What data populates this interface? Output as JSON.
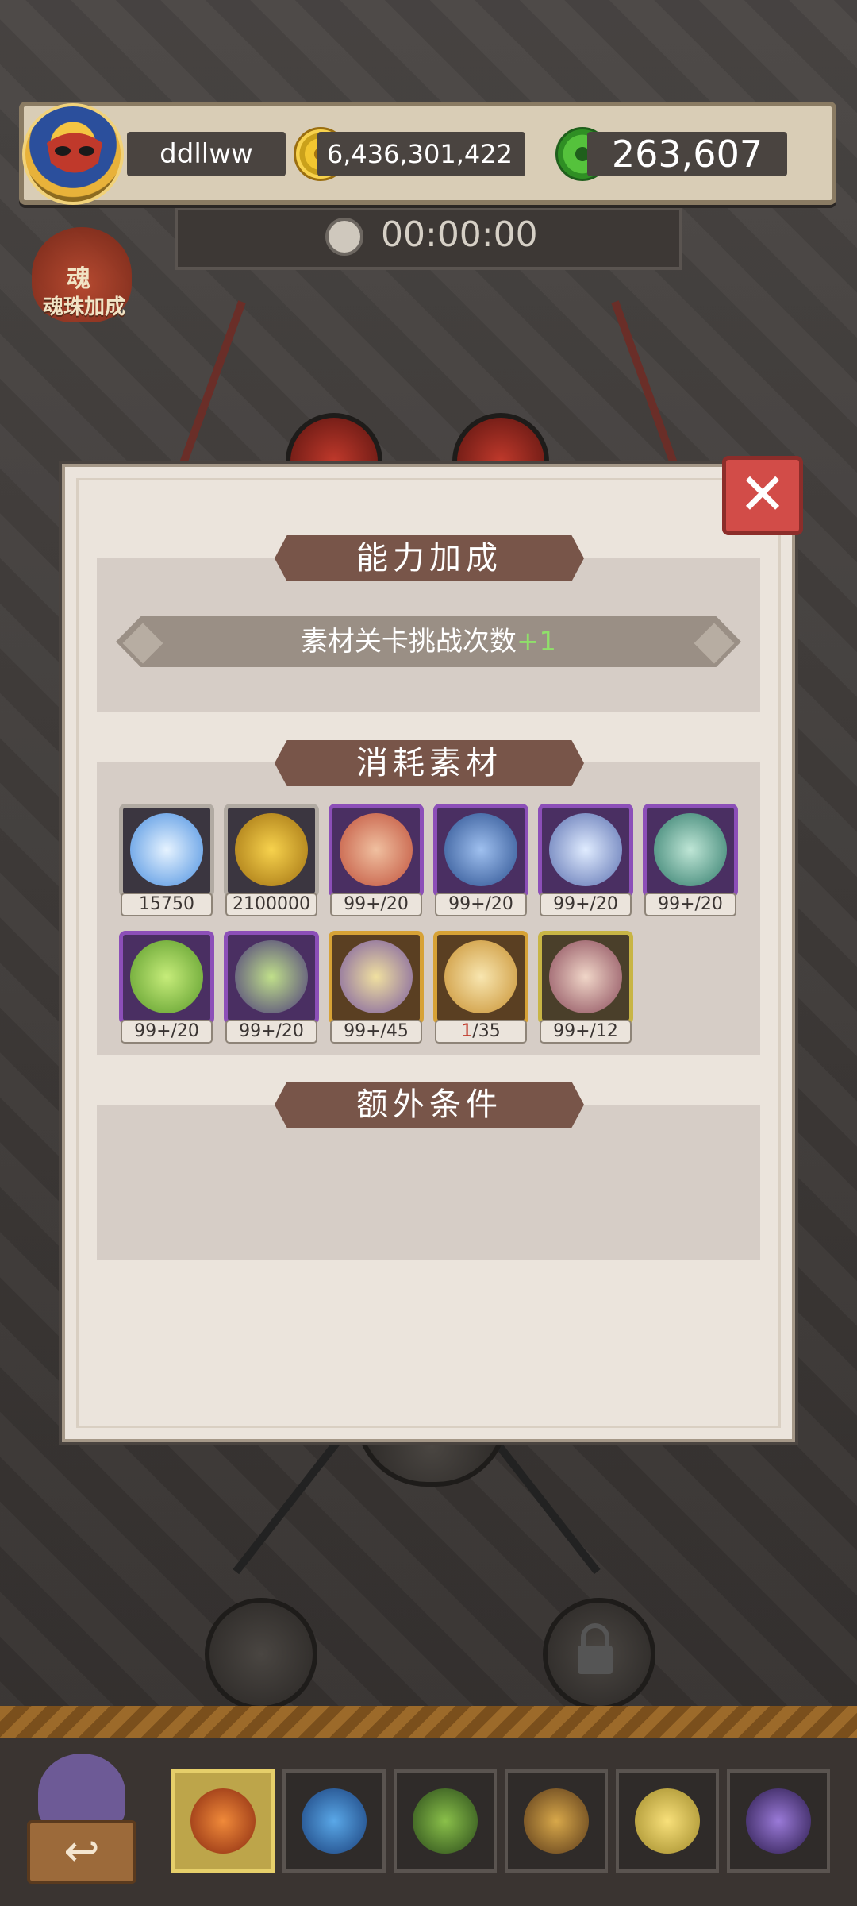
{
  "header": {
    "username": "ddllww",
    "gold": "6,436,301,422",
    "jade": "263,607",
    "timer": "00:00:00",
    "soul_bonus_char": "魂",
    "soul_bonus_label": "魂珠加成"
  },
  "modal": {
    "close_label": "✕",
    "sections": [
      {
        "title": "能力加成"
      },
      {
        "title": "消耗素材"
      },
      {
        "title": "额外条件"
      }
    ],
    "bonus_text": "素材关卡挑战次数",
    "bonus_plus": "+1",
    "materials": [
      {
        "icon": "blue-crystal-icon",
        "count": "15750",
        "frame": "gray"
      },
      {
        "icon": "gold-coin-stack-icon",
        "count": "2100000",
        "frame": "gray"
      },
      {
        "icon": "red-fire-orb-icon",
        "count": "99+/20",
        "frame": "purple"
      },
      {
        "icon": "blue-ice-orb-icon",
        "count": "99+/20",
        "frame": "purple"
      },
      {
        "icon": "cube-orb-icon",
        "count": "99+/20",
        "frame": "purple"
      },
      {
        "icon": "green-rune-orb-icon",
        "count": "99+/20",
        "frame": "purple"
      },
      {
        "icon": "leaf-cube-orb-icon",
        "count": "99+/20",
        "frame": "purple"
      },
      {
        "icon": "leaf-orb-icon",
        "count": "99+/20",
        "frame": "purple"
      },
      {
        "icon": "golden-chest-orb-icon",
        "count": "99+/45",
        "frame": "gold"
      },
      {
        "icon": "golden-hammer-orb-icon",
        "count_red": "1",
        "count": "/35",
        "frame": "gold"
      },
      {
        "icon": "dragon-orb-icon",
        "count": "99+/12",
        "frame": "goldgreen"
      }
    ]
  },
  "bottom_nav": {
    "back_label": "↩",
    "tabs": [
      {
        "icon": "fire-icon",
        "active": true
      },
      {
        "icon": "water-drop-icon",
        "active": false
      },
      {
        "icon": "leaf-icon",
        "active": false
      },
      {
        "icon": "earth-mountain-icon",
        "active": false
      },
      {
        "icon": "sun-icon",
        "active": false
      },
      {
        "icon": "moon-icon",
        "active": false
      }
    ]
  },
  "colors": {
    "ribbon": "#785549",
    "close_button": "#d24c48",
    "bonus_plus": "#8fe06a",
    "active_tab": "#bda54a"
  }
}
